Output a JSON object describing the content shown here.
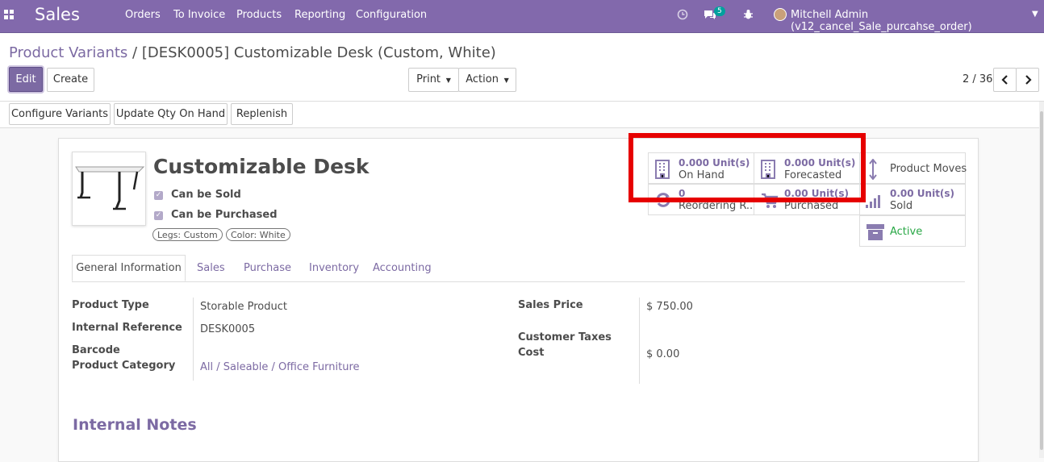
{
  "navbar": {
    "app_name": "Sales",
    "menu": [
      "Orders",
      "To Invoice",
      "Products",
      "Reporting",
      "Configuration"
    ],
    "messages_count": "5",
    "user": "Mitchell Admin (v12_cancel_Sale_purcahse_order)",
    "icons": [
      "apps-grid-icon",
      "clock-icon",
      "chat-icon",
      "bug-icon",
      "caret-down-icon"
    ]
  },
  "breadcrumb": {
    "parent": "Product Variants",
    "separator": "/",
    "current": "[DESK0005] Customizable Desk (Custom, White)"
  },
  "buttons": {
    "edit": "Edit",
    "create": "Create",
    "print": "Print",
    "action": "Action"
  },
  "pager": "2 / 36",
  "header_buttons": [
    "Configure Variants",
    "Update Qty On Hand",
    "Replenish"
  ],
  "product": {
    "name": "Customizable Desk",
    "can_be_sold": "Can be Sold",
    "can_be_purchased": "Can be Purchased",
    "attributes": [
      "Legs: Custom",
      "Color: White"
    ]
  },
  "smart_buttons": {
    "on_hand": {
      "value": "0.000",
      "unit": "Unit(s)",
      "label": "On Hand"
    },
    "forecasted": {
      "value": "0.000",
      "unit": "Unit(s)",
      "label": "Forecasted"
    },
    "product_moves": {
      "label": "Product Moves"
    },
    "reordering": {
      "value": "0",
      "label": "Reordering R..."
    },
    "purchased": {
      "value": "0.00",
      "unit": "Unit(s)",
      "label": "Purchased"
    },
    "sold": {
      "value": "0.00",
      "unit": "Unit(s)",
      "label": "Sold"
    },
    "active": {
      "label": "Active"
    }
  },
  "tabs": [
    "General Information",
    "Sales",
    "Purchase",
    "Inventory",
    "Accounting"
  ],
  "fields": {
    "product_type": {
      "label": "Product Type",
      "value": "Storable Product"
    },
    "internal_reference": {
      "label": "Internal Reference",
      "value": "DESK0005"
    },
    "barcode": {
      "label": "Barcode",
      "value": ""
    },
    "product_category": {
      "label": "Product Category",
      "value": "All / Saleable / Office Furniture"
    },
    "sales_price": {
      "label": "Sales Price",
      "value": "$ 750.00"
    },
    "customer_taxes": {
      "label": "Customer Taxes",
      "value": ""
    },
    "cost": {
      "label": "Cost",
      "value": "$ 0.00"
    }
  },
  "internal_notes": "Internal Notes",
  "colors": {
    "primary": "#7c6aa3",
    "navbar": "#8269ac",
    "highlight": "#e60000",
    "active": "#28a745"
  }
}
